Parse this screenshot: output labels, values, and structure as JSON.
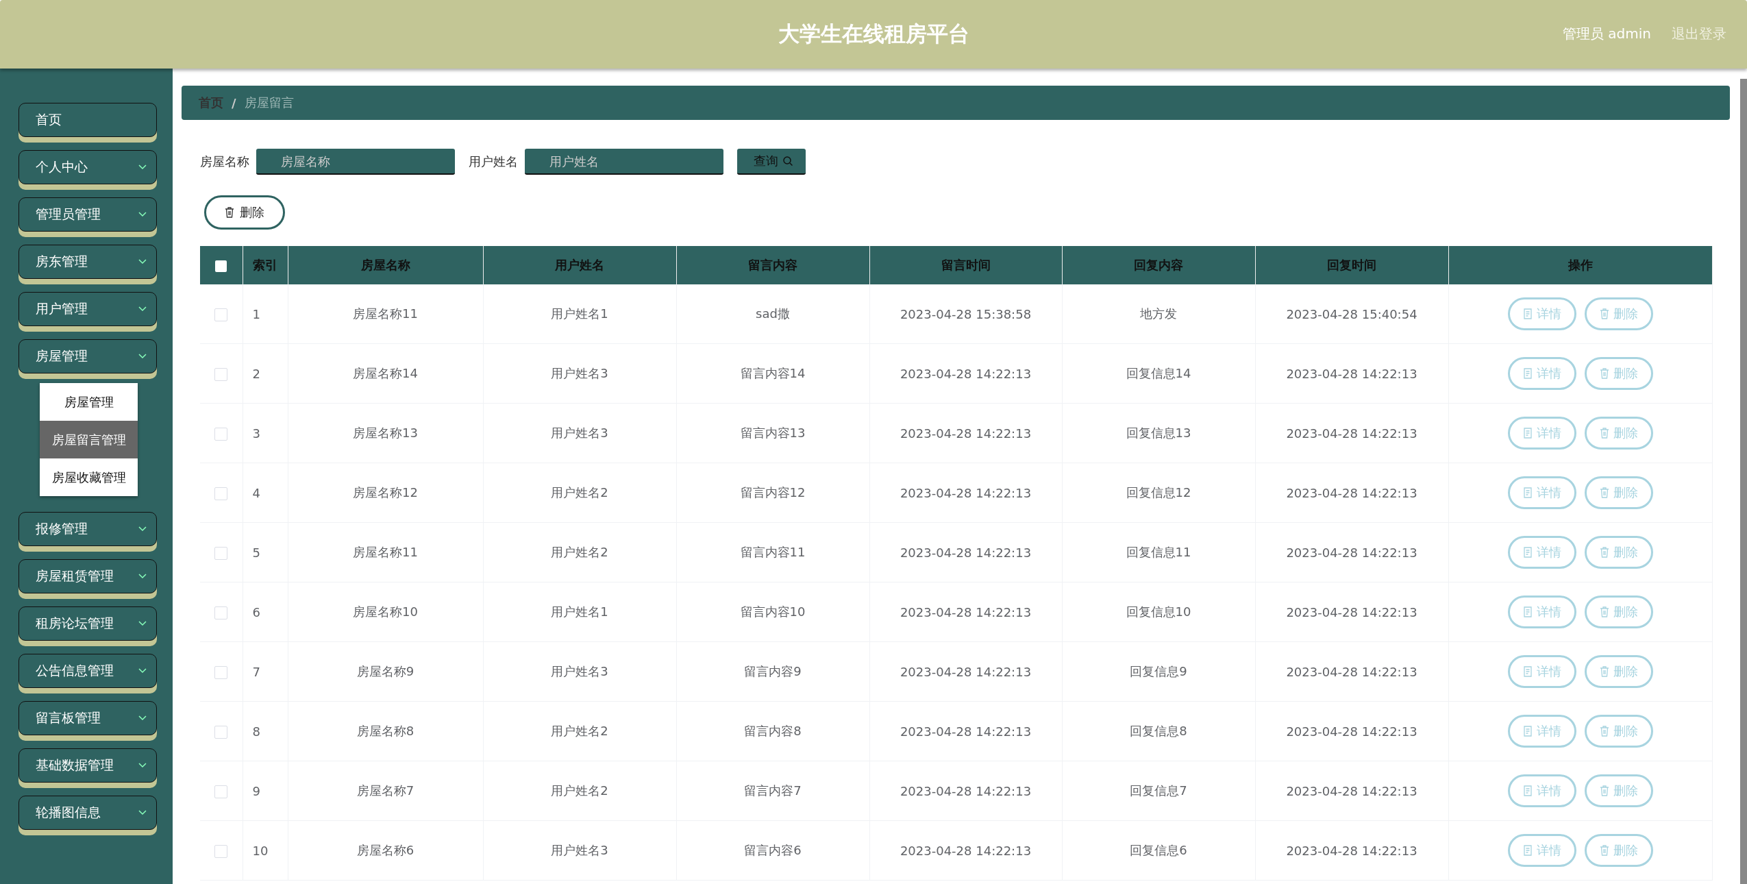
{
  "header": {
    "title": "大学生在线租房平台",
    "user": "管理员 admin",
    "logout": "退出登录"
  },
  "sidebar": {
    "items": [
      {
        "label": "首页",
        "expandable": false
      },
      {
        "label": "个人中心",
        "expandable": true
      },
      {
        "label": "管理员管理",
        "expandable": true
      },
      {
        "label": "房东管理",
        "expandable": true
      },
      {
        "label": "用户管理",
        "expandable": true
      },
      {
        "label": "房屋管理",
        "expandable": true,
        "children": [
          {
            "label": "房屋管理",
            "selected": false
          },
          {
            "label": "房屋留言管理",
            "selected": true
          },
          {
            "label": "房屋收藏管理",
            "selected": false
          }
        ]
      },
      {
        "label": "报修管理",
        "expandable": true
      },
      {
        "label": "房屋租赁管理",
        "expandable": true
      },
      {
        "label": "租房论坛管理",
        "expandable": true
      },
      {
        "label": "公告信息管理",
        "expandable": true
      },
      {
        "label": "留言板管理",
        "expandable": true
      },
      {
        "label": "基础数据管理",
        "expandable": true
      },
      {
        "label": "轮播图信息",
        "expandable": true
      }
    ]
  },
  "breadcrumb": {
    "items": [
      "首页",
      "房屋留言"
    ],
    "separator": "/"
  },
  "search": {
    "fields": [
      {
        "label": "房屋名称",
        "placeholder": "房屋名称"
      },
      {
        "label": "用户姓名",
        "placeholder": "用户姓名"
      }
    ],
    "button": "查询"
  },
  "delete_button": "删除",
  "table": {
    "select_all": false,
    "columns": [
      "索引",
      "房屋名称",
      "用户姓名",
      "留言内容",
      "留言时间",
      "回复内容",
      "回复时间",
      "操作"
    ],
    "rows": [
      {
        "checked": false,
        "actions": [
          "详情",
          "删除"
        ],
        "cells": [
          "1",
          "房屋名称11",
          "用户姓名1",
          "sad撒",
          "2023-04-28 15:38:58",
          "地方发",
          "2023-04-28 15:40:54"
        ]
      },
      {
        "checked": false,
        "actions": [
          "详情",
          "删除"
        ],
        "cells": [
          "2",
          "房屋名称14",
          "用户姓名3",
          "留言内容14",
          "2023-04-28 14:22:13",
          "回复信息14",
          "2023-04-28 14:22:13"
        ]
      },
      {
        "checked": false,
        "actions": [
          "详情",
          "删除"
        ],
        "cells": [
          "3",
          "房屋名称13",
          "用户姓名3",
          "留言内容13",
          "2023-04-28 14:22:13",
          "回复信息13",
          "2023-04-28 14:22:13"
        ]
      },
      {
        "checked": false,
        "actions": [
          "详情",
          "删除"
        ],
        "cells": [
          "4",
          "房屋名称12",
          "用户姓名2",
          "留言内容12",
          "2023-04-28 14:22:13",
          "回复信息12",
          "2023-04-28 14:22:13"
        ]
      },
      {
        "checked": false,
        "actions": [
          "详情",
          "删除"
        ],
        "cells": [
          "5",
          "房屋名称11",
          "用户姓名2",
          "留言内容11",
          "2023-04-28 14:22:13",
          "回复信息11",
          "2023-04-28 14:22:13"
        ]
      },
      {
        "checked": false,
        "actions": [
          "详情",
          "删除"
        ],
        "cells": [
          "6",
          "房屋名称10",
          "用户姓名1",
          "留言内容10",
          "2023-04-28 14:22:13",
          "回复信息10",
          "2023-04-28 14:22:13"
        ]
      },
      {
        "checked": false,
        "actions": [
          "详情",
          "删除"
        ],
        "cells": [
          "7",
          "房屋名称9",
          "用户姓名3",
          "留言内容9",
          "2023-04-28 14:22:13",
          "回复信息9",
          "2023-04-28 14:22:13"
        ]
      },
      {
        "checked": false,
        "actions": [
          "详情",
          "删除"
        ],
        "cells": [
          "8",
          "房屋名称8",
          "用户姓名2",
          "留言内容8",
          "2023-04-28 14:22:13",
          "回复信息8",
          "2023-04-28 14:22:13"
        ]
      },
      {
        "checked": false,
        "actions": [
          "详情",
          "删除"
        ],
        "cells": [
          "9",
          "房屋名称7",
          "用户姓名2",
          "留言内容7",
          "2023-04-28 14:22:13",
          "回复信息7",
          "2023-04-28 14:22:13"
        ]
      },
      {
        "checked": false,
        "actions": [
          "详情",
          "删除"
        ],
        "cells": [
          "10",
          "房屋名称6",
          "用户姓名3",
          "留言内容6",
          "2023-04-28 14:22:13",
          "回复信息6",
          "2023-04-28 14:22:13"
        ]
      }
    ]
  }
}
